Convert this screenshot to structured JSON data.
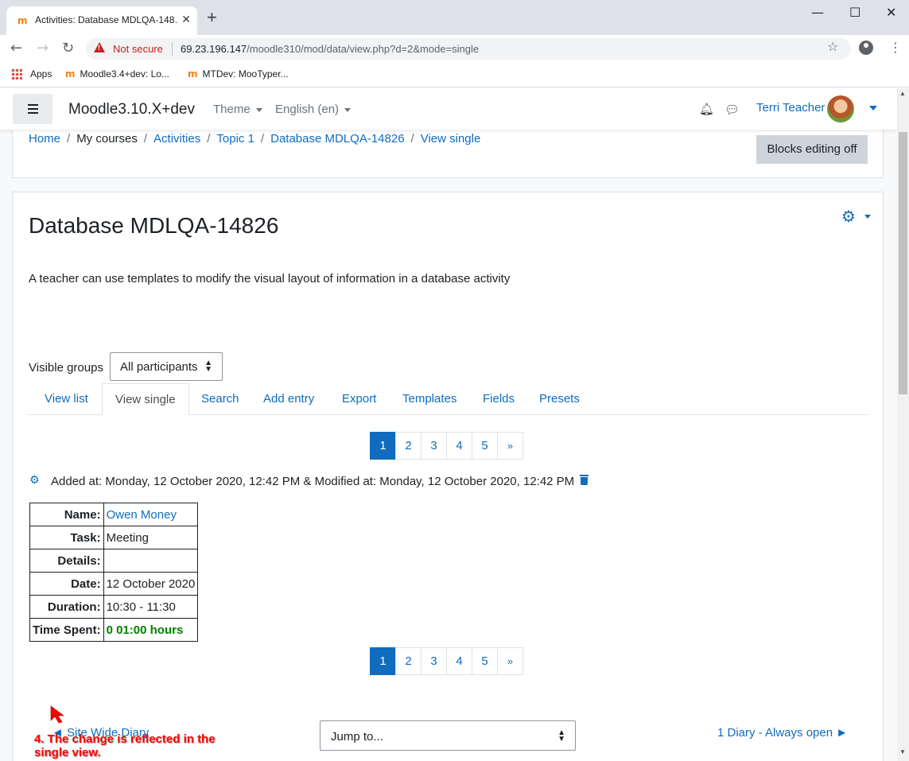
{
  "browser": {
    "tab_title": "Activities: Database MDLQA-148…",
    "not_secure": "Not secure",
    "url_host": "69.23.196.147",
    "url_path": "/moodle310/mod/data/view.php?d=2&mode=single",
    "bookmarks": [
      "Apps",
      "Moodle3.4+dev: Lo...",
      "MTDev: MooTyper..."
    ]
  },
  "navbar": {
    "site_name": "Moodle3.10.X+dev",
    "theme_label": "Theme",
    "language_label": "English (en)",
    "user_name": "Terri Teacher"
  },
  "breadcrumb": [
    "Home",
    "My courses",
    "Activities",
    "Topic 1",
    "Database MDLQA-14826",
    "View single"
  ],
  "blocks_editing_label": "Blocks editing off",
  "page_title": "Database MDLQA-14826",
  "intro": "A teacher can use templates to modify the visual layout of information in a database activity",
  "groups": {
    "label": "Visible groups",
    "selected": "All participants"
  },
  "tabs": [
    "View list",
    "View single",
    "Search",
    "Add entry",
    "Export",
    "Templates",
    "Fields",
    "Presets"
  ],
  "active_tab": "View single",
  "pager": {
    "pages": [
      "1",
      "2",
      "3",
      "4",
      "5"
    ],
    "current": "1",
    "next": "»"
  },
  "entry_meta": "Added at: Monday, 12 October 2020, 12:42 PM & Modified at: Monday, 12 October 2020, 12:42 PM",
  "entry": {
    "rows": [
      {
        "label": "Name:",
        "value": "Owen Money"
      },
      {
        "label": "Task:",
        "value": "Meeting"
      },
      {
        "label": "Details:",
        "value": ""
      },
      {
        "label": "Date:",
        "value": "12 October 2020"
      },
      {
        "label": "Duration:",
        "value": "10:30 - 11:30"
      },
      {
        "label": "Time Spent:",
        "value": "0 01:00 hours"
      }
    ]
  },
  "annotation": "4. The change is reflected in the single view.",
  "footer_nav": {
    "prev": "◄ Site Wide Diary",
    "jump": "Jump to...",
    "next": "1 Diary - Always open ►"
  },
  "colors": {
    "link": "#0f6cbf",
    "annotation": "#ff0000",
    "time_spent": "#008000"
  }
}
